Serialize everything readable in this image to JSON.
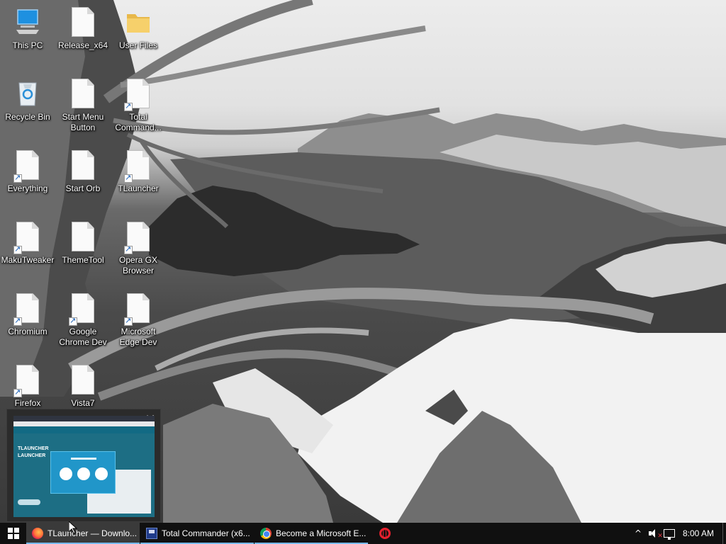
{
  "desktop": {
    "icons": [
      {
        "label": "This PC",
        "icon": "this-pc-icon"
      },
      {
        "label": "Release_x64",
        "icon": "file-icon"
      },
      {
        "label": "User Files",
        "icon": "folder-icon"
      },
      {
        "label": "Recycle Bin",
        "icon": "recycle-bin-icon"
      },
      {
        "label": "Start Menu Button",
        "icon": "file-icon"
      },
      {
        "label": "Total Command...",
        "icon": "shortcut-file-icon"
      },
      {
        "label": "Everything",
        "icon": "shortcut-file-icon"
      },
      {
        "label": "Start Orb",
        "icon": "file-icon"
      },
      {
        "label": "TLauncher",
        "icon": "shortcut-file-icon"
      },
      {
        "label": "MakuTweaker",
        "icon": "shortcut-file-icon"
      },
      {
        "label": "ThemeTool",
        "icon": "file-icon"
      },
      {
        "label": "Opera GX Browser",
        "icon": "shortcut-file-icon"
      },
      {
        "label": "Chromium",
        "icon": "shortcut-file-icon"
      },
      {
        "label": "Google Chrome Dev",
        "icon": "shortcut-file-icon"
      },
      {
        "label": "Microsoft Edge Dev",
        "icon": "shortcut-file-icon"
      },
      {
        "label": "Firefox",
        "icon": "shortcut-file-icon"
      },
      {
        "label": "Vista7",
        "icon": "file-icon"
      }
    ]
  },
  "thumbnail": {
    "close_glyph": "✕",
    "logo_line1": "TLAUNCHER",
    "logo_line2": "LAUNCHER"
  },
  "taskbar": {
    "windows": [
      {
        "label": "TLauncher — Downlo...",
        "icon": "firefox-icon",
        "active": true
      },
      {
        "label": "Total Commander (x6...",
        "icon": "total-commander-icon",
        "active": false
      },
      {
        "label": "Become a Microsoft E...",
        "icon": "chrome-icon",
        "active": false
      }
    ],
    "pinned": [
      {
        "icon": "opera-gx-icon"
      }
    ],
    "tray": {
      "chevron": "^",
      "time": "8:00 AM"
    }
  },
  "colors": {
    "taskbar_bg": "#101010",
    "active_indicator": "#76b9ed"
  }
}
